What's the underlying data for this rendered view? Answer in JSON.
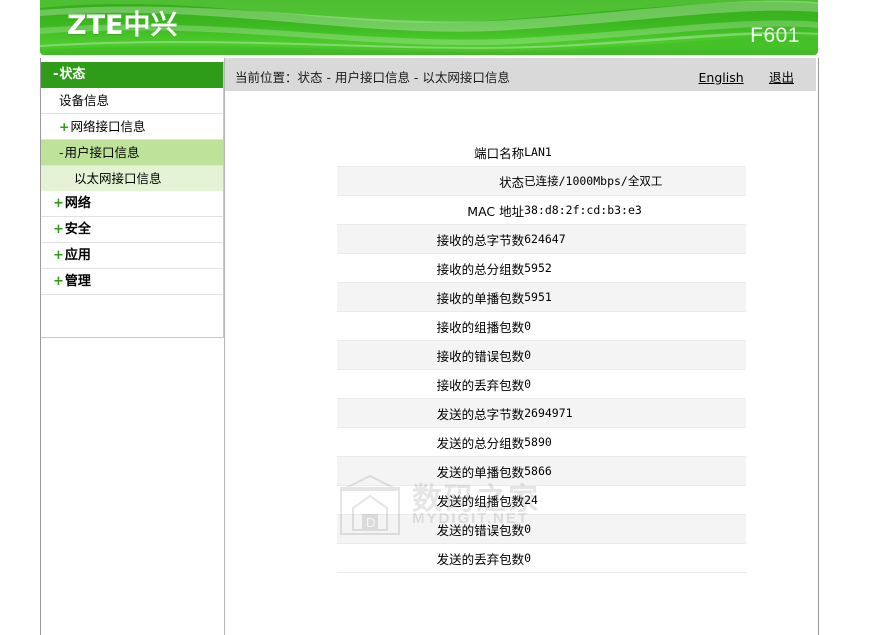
{
  "banner": {
    "logo_text": "ZTE中兴",
    "model": "F601"
  },
  "topbar": {
    "breadcrumb": "当前位置：状态 - 用户接口信息 - 以太网接口信息",
    "english_link": "English",
    "logout_link": "退出"
  },
  "sidebar": {
    "items": [
      {
        "label": "状态",
        "level": 0,
        "expander": "-",
        "state": "active"
      },
      {
        "label": "设备信息",
        "level": 1,
        "expander": "",
        "state": "normal"
      },
      {
        "label": "网络接口信息",
        "level": 1,
        "expander": "+",
        "state": "normal"
      },
      {
        "label": "用户接口信息",
        "level": 1,
        "expander": "-",
        "state": "selected"
      },
      {
        "label": "以太网接口信息",
        "level": 2,
        "expander": "",
        "state": "child"
      },
      {
        "label": "网络",
        "level": 0,
        "expander": "+",
        "state": "normal"
      },
      {
        "label": "安全",
        "level": 0,
        "expander": "+",
        "state": "normal"
      },
      {
        "label": "应用",
        "level": 0,
        "expander": "+",
        "state": "normal"
      },
      {
        "label": "管理",
        "level": 0,
        "expander": "+",
        "state": "normal"
      }
    ]
  },
  "table": {
    "rows": [
      {
        "label": "端口名称",
        "value": "LAN1"
      },
      {
        "label": "状态",
        "value": "已连接/1000Mbps/全双工"
      },
      {
        "label": "MAC 地址",
        "value": "38:d8:2f:cd:b3:e3"
      },
      {
        "label": "接收的总字节数",
        "value": "624647"
      },
      {
        "label": "接收的总分组数",
        "value": "5952"
      },
      {
        "label": "接收的单播包数",
        "value": "5951"
      },
      {
        "label": "接收的组播包数",
        "value": "0"
      },
      {
        "label": "接收的错误包数",
        "value": "0"
      },
      {
        "label": "接收的丢弃包数",
        "value": "0"
      },
      {
        "label": "发送的总字节数",
        "value": "2694971"
      },
      {
        "label": "发送的总分组数",
        "value": "5890"
      },
      {
        "label": "发送的单播包数",
        "value": "5866"
      },
      {
        "label": "发送的组播包数",
        "value": "24"
      },
      {
        "label": "发送的错误包数",
        "value": "0"
      },
      {
        "label": "发送的丢弃包数",
        "value": "0"
      }
    ]
  },
  "watermark": {
    "text": "数码之家",
    "subtext": "MYDIGIT.NET",
    "logo_letter": "D"
  },
  "colors": {
    "brand_green": "#3cb521",
    "active_menu": "#2e9c18",
    "selected_menu": "#bfe29a",
    "child_menu": "#e4f3d4",
    "topbar_gray": "#d9d9d9",
    "row_alt": "#f4f4f4"
  }
}
